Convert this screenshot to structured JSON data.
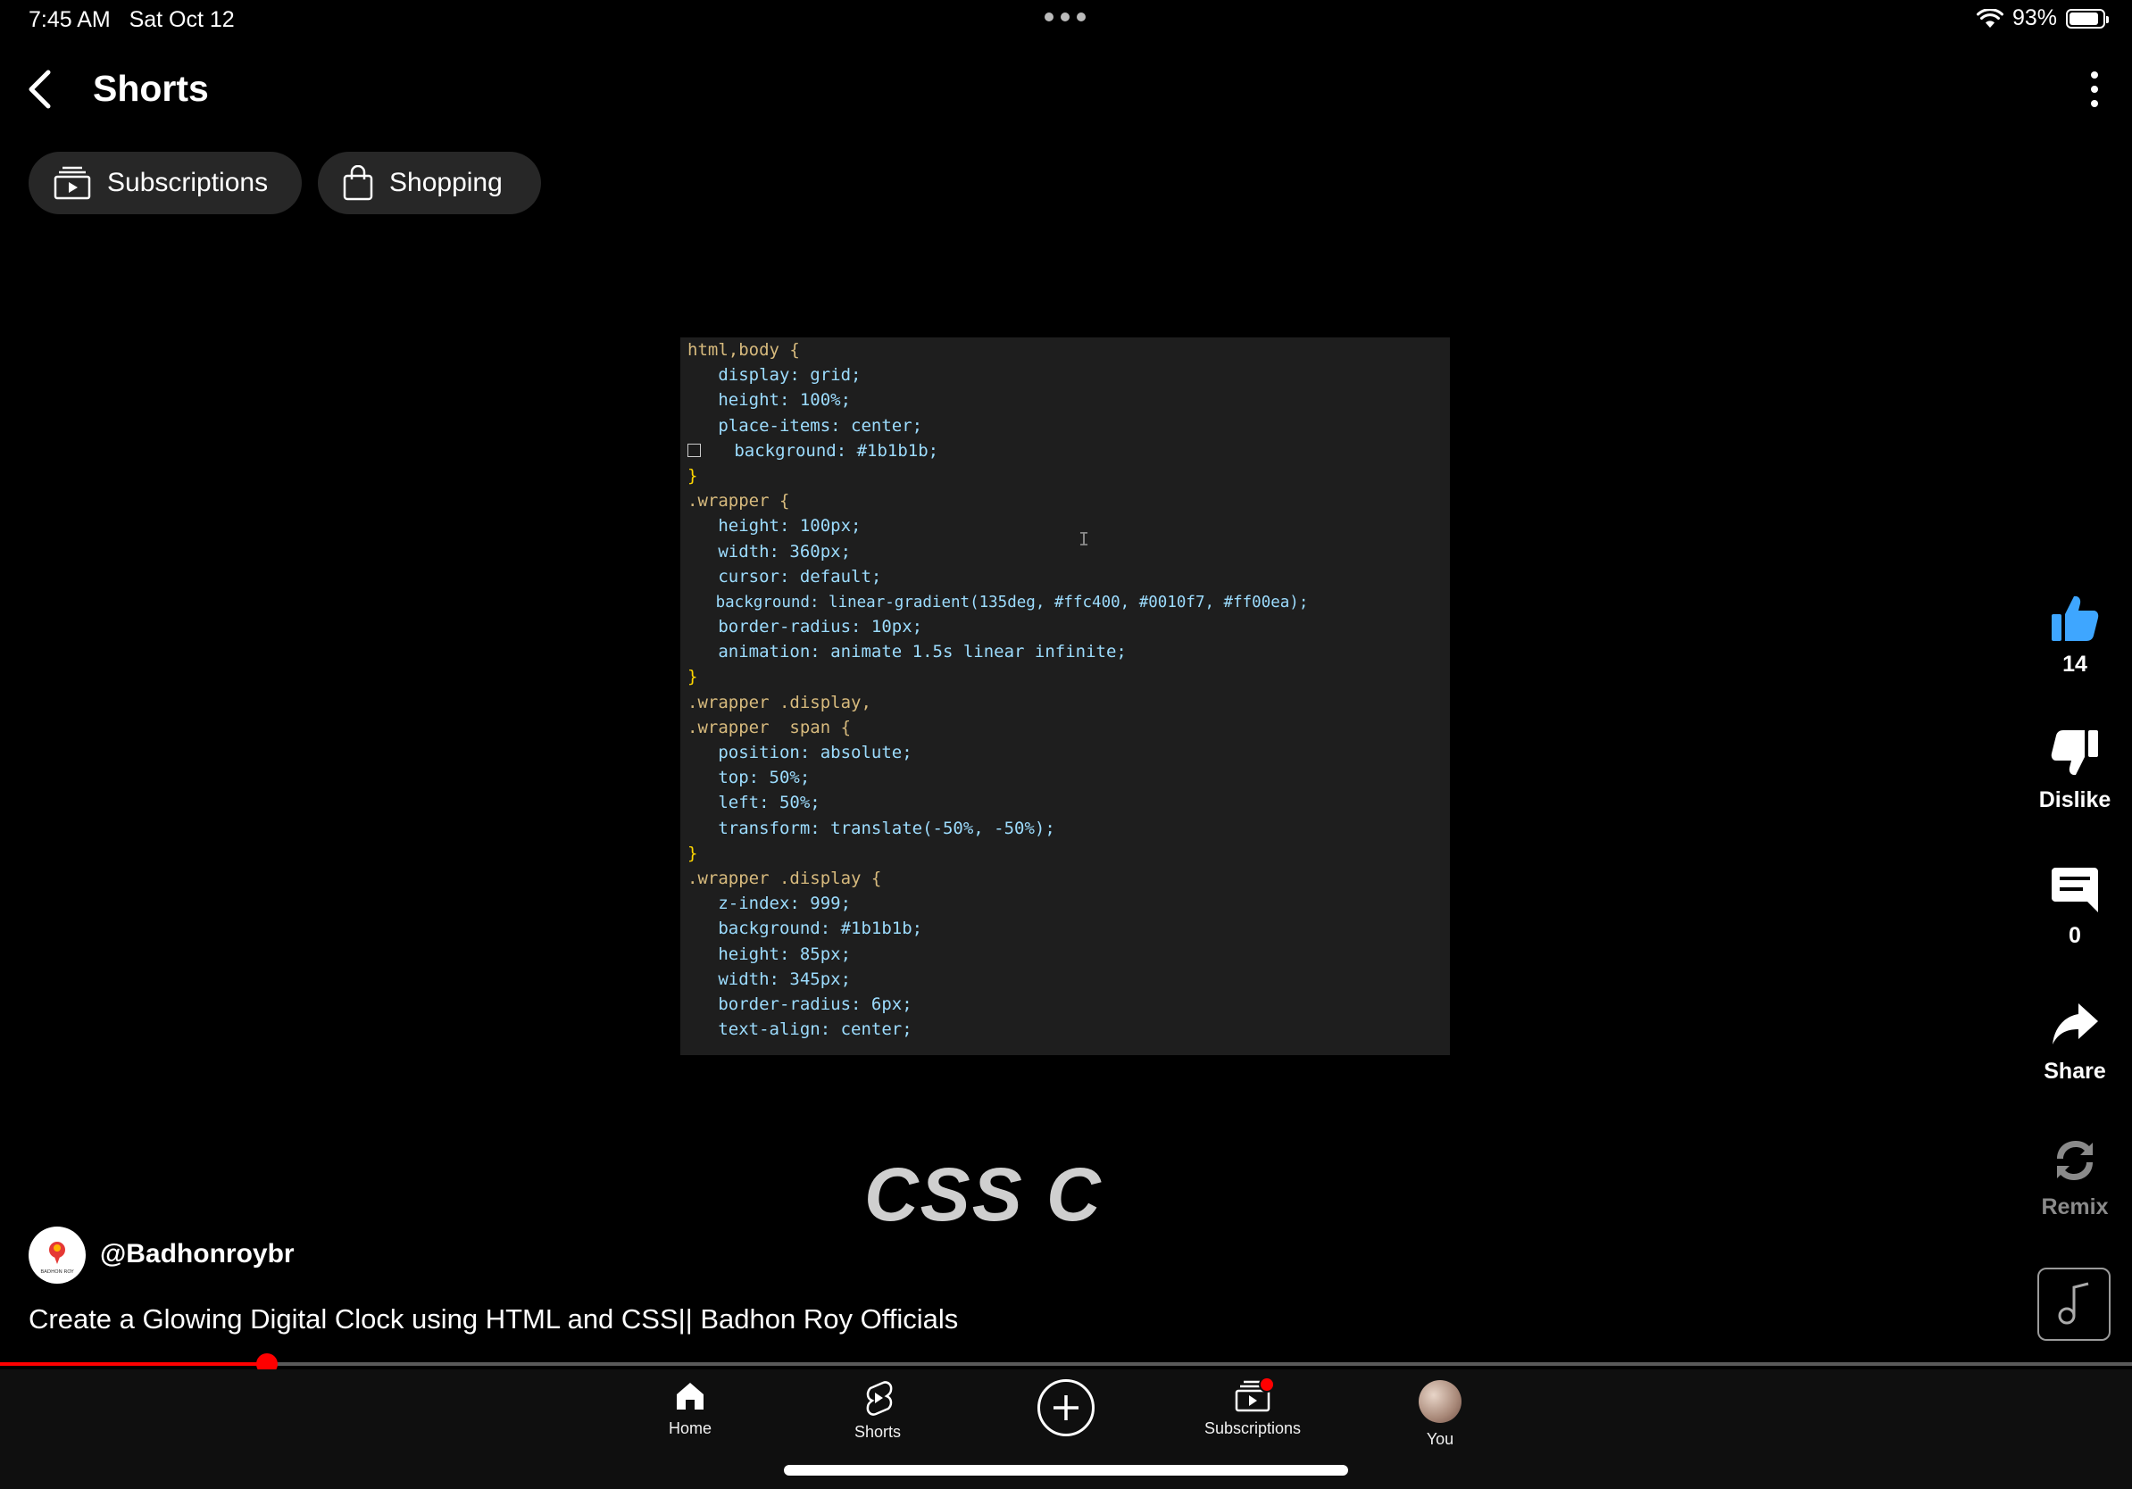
{
  "status_bar": {
    "time": "7:45 AM",
    "date": "Sat Oct 12",
    "battery": "93%",
    "battery_level": 0.93,
    "icons": [
      "wifi-icon",
      "battery-icon"
    ]
  },
  "header": {
    "title": "Shorts",
    "back_icon": "chevron-left-icon",
    "more_icon": "more-vertical-icon"
  },
  "chips": [
    {
      "label": "Subscriptions",
      "icon": "subscriptions-icon"
    },
    {
      "label": "Shopping",
      "icon": "shopping-bag-icon"
    }
  ],
  "video": {
    "code_lines": [
      "html,body {",
      "   display: grid;",
      "   height: 100%;",
      "   place-items: center;",
      "   background: #1b1b1b;",
      "}",
      ".wrapper {",
      "   height: 100px;",
      "   width: 360px;",
      "   cursor: default;",
      "   background: linear-gradient(135deg, #ffc400, #0010f7, #ff00ea);",
      "   border-radius: 10px;",
      "   animation: animate 1.5s linear infinite;",
      "}",
      ".wrapper .display,",
      ".wrapper  span {",
      "   position: absolute;",
      "   top: 50%;",
      "   left: 50%;",
      "   transform: translate(-50%, -50%);",
      "}",
      ".wrapper .display {",
      "   z-index: 999;",
      "   background: #1b1b1b;",
      "   height: 85px;",
      "   width: 345px;",
      "   border-radius: 6px;",
      "   text-align: center;"
    ],
    "swatch_colors": [
      "#1b1b1b",
      "#ffc400",
      "#0010f7",
      "#ff00ea"
    ],
    "text_cursor": "I",
    "overlay_text": "CSS  C",
    "progress": 0.125
  },
  "actions": {
    "like": {
      "label": "14",
      "icon": "thumbs-up-icon",
      "color": "#3ea6ff"
    },
    "dislike": {
      "label": "Dislike",
      "icon": "thumbs-down-icon"
    },
    "comments": {
      "label": "0",
      "icon": "comment-icon"
    },
    "share": {
      "label": "Share",
      "icon": "share-icon"
    },
    "remix": {
      "label": "Remix",
      "icon": "remix-icon"
    },
    "sound": {
      "icon": "music-note-icon"
    }
  },
  "channel": {
    "handle": "@Badhonroybr",
    "avatar_text": "BADHON ROY"
  },
  "title": "Create a Glowing Digital Clock using HTML and CSS|| Badhon Roy Officials",
  "nav": [
    {
      "label": "Home",
      "icon": "home-icon"
    },
    {
      "label": "Shorts",
      "icon": "shorts-icon"
    },
    {
      "label": "",
      "icon": "plus-circle-icon"
    },
    {
      "label": "Subscriptions",
      "icon": "subscriptions-icon",
      "badge": true
    },
    {
      "label": "You",
      "icon": "avatar"
    }
  ],
  "colors": {
    "accent": "#ff0000",
    "like": "#3ea6ff",
    "chip_bg": "#272727"
  }
}
